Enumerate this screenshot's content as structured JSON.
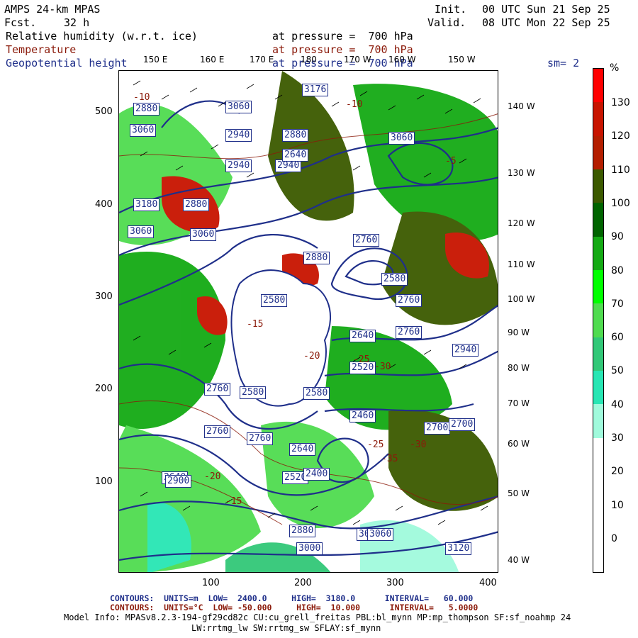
{
  "header": {
    "model": "AMPS 24-km MPAS",
    "fcst_label": "Fcst.",
    "fcst_value": "32 h",
    "init_label": "Init.",
    "init_value": "00 UTC Sun 21 Sep 25",
    "valid_label": "Valid.",
    "valid_value": "08 UTC Mon 22 Sep 25",
    "fields": [
      {
        "name": "Relative humidity (w.r.t. ice)",
        "level": "at pressure =  700 hPa",
        "color": "#000000"
      },
      {
        "name": "Temperature",
        "level": "at pressure =  700 hPa",
        "color": "#8b1a0a"
      },
      {
        "name": "Geopotential height",
        "level": "at pressure =  700 hPa",
        "color": "#1f2f8a"
      }
    ],
    "smoothing": "sm= 2"
  },
  "map": {
    "x_ticks": [
      "100",
      "200",
      "300",
      "400"
    ],
    "y_ticks": [
      "500",
      "400",
      "300",
      "200",
      "100"
    ],
    "top_lon_labels": [
      "150 E",
      "160 E",
      "170 E",
      "180",
      "170 W",
      "160 W",
      "150 W"
    ],
    "right_lon_labels": [
      "140 W",
      "130 W",
      "120 W",
      "110 W",
      "100 W",
      "90 W",
      "80 W",
      "70 W",
      "60 W",
      "50 W",
      "40 W"
    ],
    "contour_labels": [
      "3176",
      "3060",
      "2940",
      "3060",
      "2880",
      "2940",
      "3060",
      "3180",
      "3060",
      "2880",
      "2640",
      "2760",
      "2880",
      "2580",
      "2580",
      "2760",
      "2640",
      "2520",
      "2460",
      "2700",
      "2940",
      "2760",
      "2580",
      "2580",
      "2760",
      "2640",
      "2520",
      "2400",
      "2880",
      "2940",
      "3060",
      "3000",
      "3120",
      "3060",
      "2900",
      "2700",
      "2760",
      "2640",
      "2760",
      "3000",
      "2880"
    ],
    "red_labels": [
      "-10",
      "-10",
      "-5",
      "-15",
      "-20",
      "-25",
      "-30",
      "-35",
      "-30",
      "-25",
      "-20",
      "-15"
    ],
    "icons": [
      "map-land-icon",
      "contour-line-icon",
      "wind-barb-icon"
    ]
  },
  "colorbar": {
    "unit": "%",
    "labels": [
      "130",
      "120",
      "110",
      "100",
      "90",
      "80",
      "70",
      "60",
      "50",
      "40",
      "30",
      "20",
      "10",
      "0"
    ],
    "colors": [
      "#ff0000",
      "#c81400",
      "#b41e00",
      "#3c5a00",
      "#006400",
      "#14aa14",
      "#00ff00",
      "#50dc50",
      "#32c878",
      "#28e6b4",
      "#a0fadc",
      "#ffffff",
      "#ffffff",
      "#ffffff",
      "#ffffff"
    ]
  },
  "footer": {
    "height_line": "CONTOURS:  UNITS=m  LOW=  2400.0     HIGH=  3180.0      INTERVAL=   60.000",
    "temp_line": "CONTOURS:  UNITS=°C  LOW= -50.000     HIGH=  10.000      INTERVAL=   5.0000",
    "model_info_1": "Model Info: MPASv8.2.3-194-gf29cd82c CU:cu_grell_freitas PBL:bl_mynn MP:mp_thompson SF:sf_noahmp 24",
    "model_info_2": "LW:rrtmg_lw SW:rrtmg_sw SFLAY:sf_mynn"
  }
}
